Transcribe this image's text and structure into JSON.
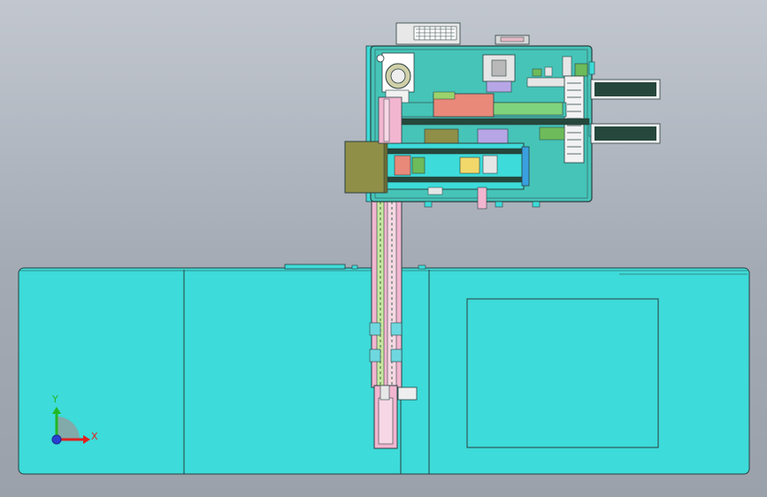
{
  "view": {
    "background_top": "#c2c7cf",
    "background_bottom": "#9aa1ab",
    "line_color": "#2a3f3f"
  },
  "colors": {
    "base_cyan": "#3ddbd9",
    "panel_teal": "#46c4b8",
    "olive_block": "#8f8f47",
    "pink_rail": "#f2b6d0",
    "salmon_block": "#e8897a",
    "green_block": "#6dbb5a",
    "dark_conveyor": "#25473c",
    "blue_cylinder": "#3aa0e0",
    "lavender": "#b7a6e6"
  },
  "triad": {
    "x_label": "X",
    "y_label": "Y",
    "x_color": "#e02020",
    "y_color": "#22b722",
    "origin_color": "#2a3fd0"
  }
}
